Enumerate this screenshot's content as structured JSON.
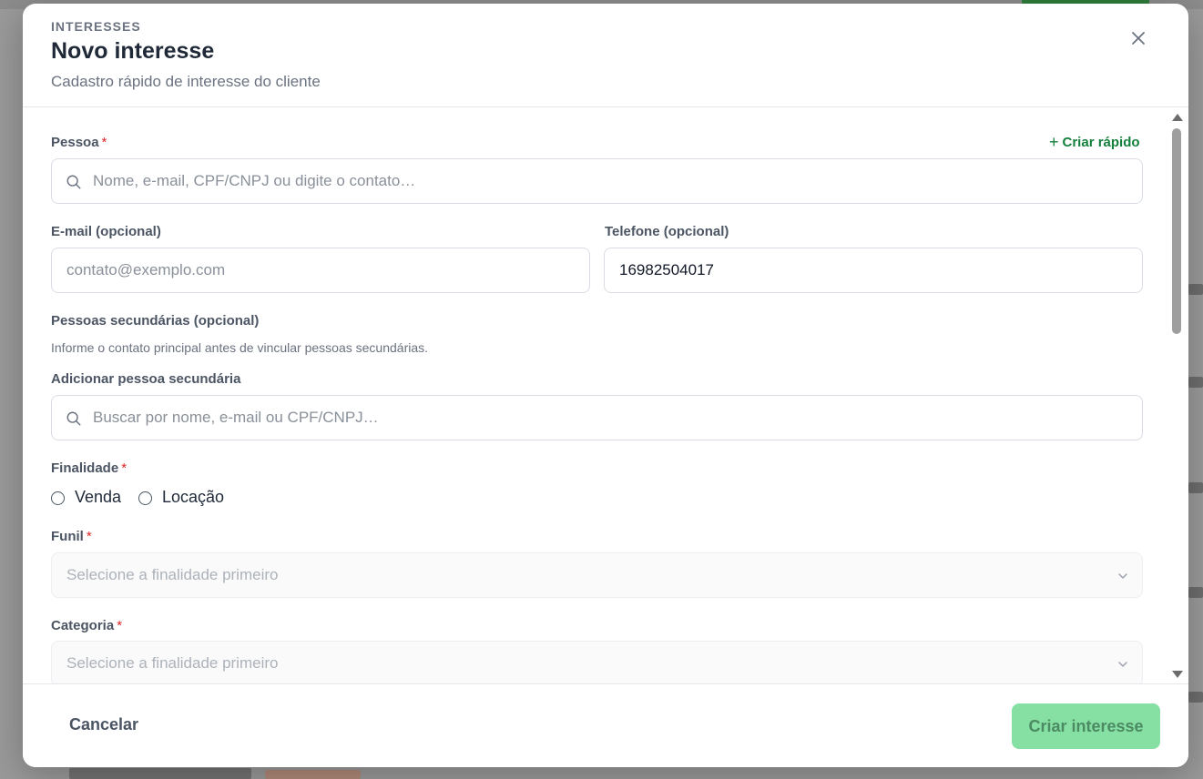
{
  "modal": {
    "eyebrow": "INTERESSES",
    "title": "Novo interesse",
    "subtitle": "Cadastro rápido de interesse do cliente"
  },
  "form": {
    "pessoa": {
      "label": "Pessoa",
      "required_mark": "*",
      "quick_create": "Criar rápido",
      "placeholder": "Nome, e-mail, CPF/CNPJ ou digite o contato…"
    },
    "email": {
      "label": "E-mail (opcional)",
      "placeholder": "contato@exemplo.com",
      "value": ""
    },
    "telefone": {
      "label": "Telefone (opcional)",
      "value": "16982504017"
    },
    "secundarias": {
      "label": "Pessoas secundárias (opcional)",
      "hint": "Informe o contato principal antes de vincular pessoas secundárias.",
      "add_label": "Adicionar pessoa secundária",
      "placeholder": "Buscar por nome, e-mail ou CPF/CNPJ…"
    },
    "finalidade": {
      "label": "Finalidade",
      "required_mark": "*",
      "options": [
        "Venda",
        "Locação"
      ]
    },
    "funil": {
      "label": "Funil",
      "required_mark": "*",
      "placeholder": "Selecione a finalidade primeiro"
    },
    "categoria": {
      "label": "Categoria",
      "required_mark": "*",
      "placeholder": "Selecione a finalidade primeiro"
    }
  },
  "footer": {
    "cancel_label": "Cancelar",
    "submit_label": "Criar interesse"
  },
  "colors": {
    "accent": "#15803d",
    "submit_disabled_bg": "#86e0a4",
    "required": "#dc2626"
  }
}
